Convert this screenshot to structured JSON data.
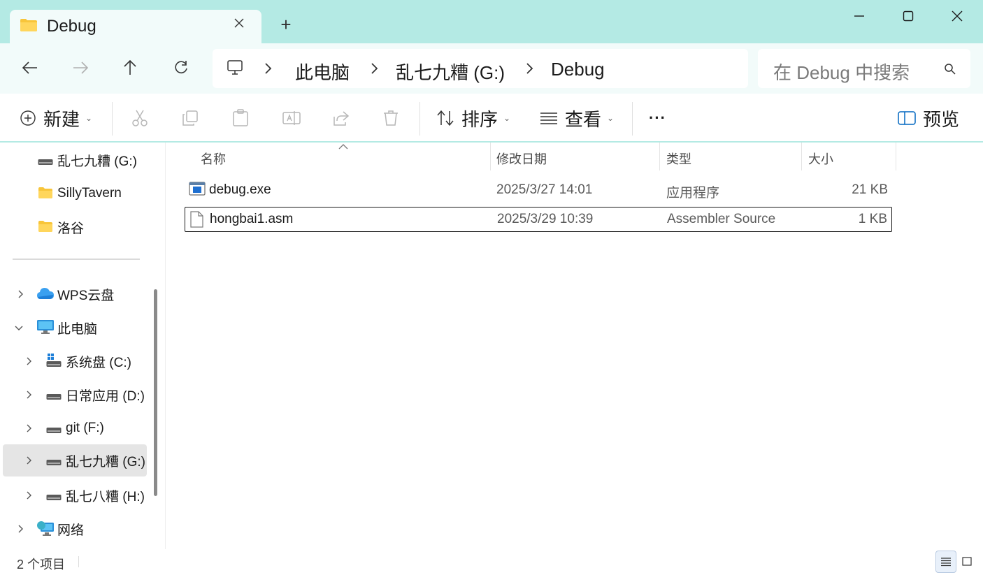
{
  "window": {
    "tab_title": "Debug",
    "tab_close_icon": "close-icon",
    "new_tab_label": "+",
    "controls": [
      "minimize-icon",
      "maximize-icon",
      "close-icon"
    ]
  },
  "nav": {
    "buttons": [
      "back-arrow-icon",
      "forward-arrow-icon",
      "up-arrow-icon",
      "refresh-icon"
    ],
    "breadcrumb": [
      "此电脑",
      "乱七九糟 (G:)",
      "Debug"
    ],
    "search_placeholder": "在 Debug 中搜索"
  },
  "commandbar": {
    "new_label": "新建",
    "sort_label": "排序",
    "view_label": "查看",
    "more_label": "···",
    "preview_label": "预览",
    "disabled_actions": [
      "cut-icon",
      "copy-icon",
      "paste-icon",
      "rename-icon",
      "share-icon",
      "delete-icon"
    ]
  },
  "sidebar": {
    "quick_items": [
      {
        "label": "乱七九糟 (G:)",
        "icon": "drive-icon"
      },
      {
        "label": "SillyTavern",
        "icon": "folder-icon"
      },
      {
        "label": "洛谷",
        "icon": "folder-icon"
      }
    ],
    "wps": "WPS云盘",
    "this_pc": "此电脑",
    "drives": [
      {
        "label": "系统盘 (C:)",
        "icon": "windows-drive-icon"
      },
      {
        "label": "日常应用 (D:)",
        "icon": "drive-icon"
      },
      {
        "label": "git (F:)",
        "icon": "drive-icon"
      },
      {
        "label": "乱七九糟 (G:)",
        "icon": "drive-icon",
        "selected": true
      },
      {
        "label": "乱七八糟 (H:)",
        "icon": "drive-icon"
      }
    ],
    "network": "网络"
  },
  "columns": {
    "name": "名称",
    "date": "修改日期",
    "type": "类型",
    "size": "大小"
  },
  "files": [
    {
      "name": "debug.exe",
      "date": "2025/3/27 14:01",
      "type": "应用程序",
      "size": "21 KB",
      "icon": "exe-file-icon"
    },
    {
      "name": "hongbai1.asm",
      "date": "2025/3/29 10:39",
      "type": "Assembler Source",
      "size": "1 KB",
      "icon": "text-file-icon",
      "focused": true
    }
  ],
  "status": {
    "count": "2 个项目"
  },
  "colors": {
    "titlebar": "#b4eae4",
    "navbar": "#f2fbfa",
    "folder": "#f8c53a",
    "accent": "#0067c0"
  }
}
